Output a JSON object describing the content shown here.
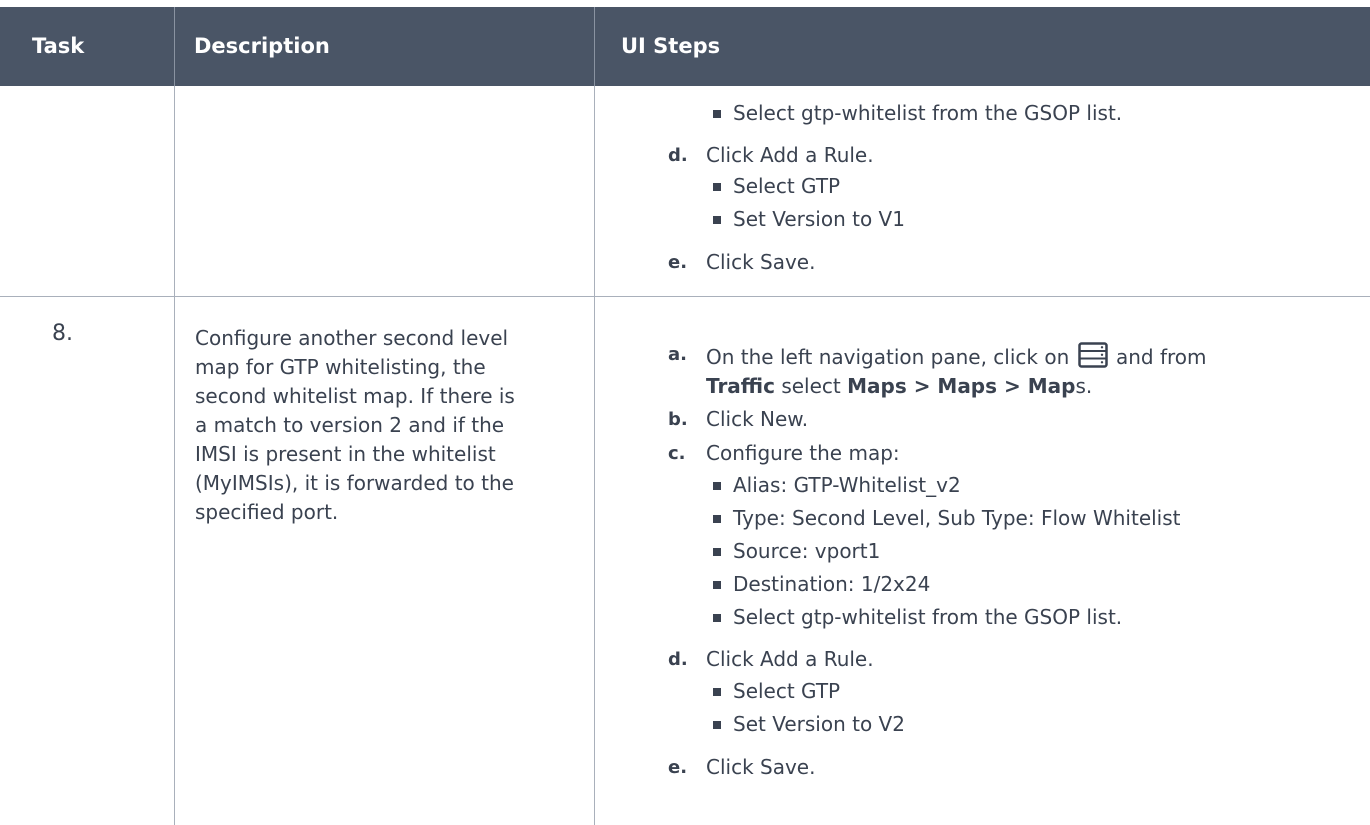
{
  "header": {
    "task": "Task",
    "description": "Description",
    "ui_steps": "UI Steps"
  },
  "row_prev": {
    "b1": "Select gtp-whitelist from the GSOP list.",
    "d_letter": "d.",
    "d_text": "Click Add a Rule.",
    "b2": "Select GTP",
    "b3": "Set Version to V1",
    "e_letter": "e.",
    "e_text": "Click Save."
  },
  "row8": {
    "task": "8.",
    "description_lines": [
      "Configure another second level",
      "map for GTP whitelisting, the",
      "second whitelist map. If there is",
      "a match to version 2 and if the",
      "IMSI is present in the whitelist",
      "(MyIMSIs), it is forwarded to the",
      "specified port."
    ],
    "a_letter": "a.",
    "a_line1_pre": "On the left navigation pane, click on",
    "a_line1_post": "and from",
    "a_traffic": "Traffic",
    "a_select": " select ",
    "a_maps": "Maps > Maps > Map",
    "a_s": "s.",
    "b_letter": "b.",
    "b_text": "Click New.",
    "c_letter": "c.",
    "c_text": "Configure the map:",
    "c_items": [
      "Alias: GTP-Whitelist_v2",
      "Type: Second Level, Sub Type: Flow Whitelist",
      "Source: vport1",
      "Destination: 1/2x24",
      "Select gtp-whitelist from the GSOP list."
    ],
    "d_letter": "d.",
    "d_text": "Click Add a Rule.",
    "d_items": [
      "Select GTP",
      "Set Version to V2"
    ],
    "e_letter": "e.",
    "e_text": "Click Save."
  },
  "colors": {
    "header_bg": "#4a5566",
    "text": "#3a4250",
    "grid": "#a9b0bb"
  }
}
